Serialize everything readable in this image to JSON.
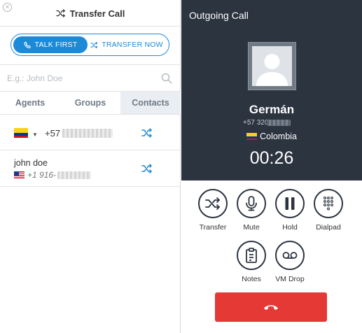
{
  "transfer_panel": {
    "title": "Transfer Call",
    "modes": [
      {
        "label": "TALK FIRST",
        "active": true
      },
      {
        "label": "TRANSFER NOW",
        "active": false
      }
    ],
    "search": {
      "placeholder": "E.g.: John Doe",
      "value": ""
    },
    "tabs": [
      {
        "label": "Agents",
        "active": false
      },
      {
        "label": "Groups",
        "active": false
      },
      {
        "label": "Contacts",
        "active": true
      }
    ],
    "contacts": [
      {
        "type": "number_entry",
        "country_flag": "colombia",
        "prefix": "+57"
      },
      {
        "type": "contact",
        "name": "john doe",
        "country_flag": "united-states",
        "number": "+1 916-"
      }
    ]
  },
  "call_panel": {
    "title": "Outgoing Call",
    "caller_name": "Germán",
    "caller_number": "+57 320",
    "caller_country": "Colombia",
    "timer": "00:26",
    "actions": [
      {
        "label": "Transfer",
        "icon": "transfer-icon"
      },
      {
        "label": "Mute",
        "icon": "microphone-icon"
      },
      {
        "label": "Hold",
        "icon": "pause-icon"
      },
      {
        "label": "Dialpad",
        "icon": "dialpad-icon"
      },
      {
        "label": "Notes",
        "icon": "clipboard-icon"
      },
      {
        "label": "VM Drop",
        "icon": "voicemail-icon"
      }
    ],
    "hangup_icon": "hang-up-icon"
  },
  "colors": {
    "accent": "#1b8ad8",
    "dark_panel": "#2c3440",
    "hangup": "#e53935",
    "active_tab": "#eaedf1"
  }
}
